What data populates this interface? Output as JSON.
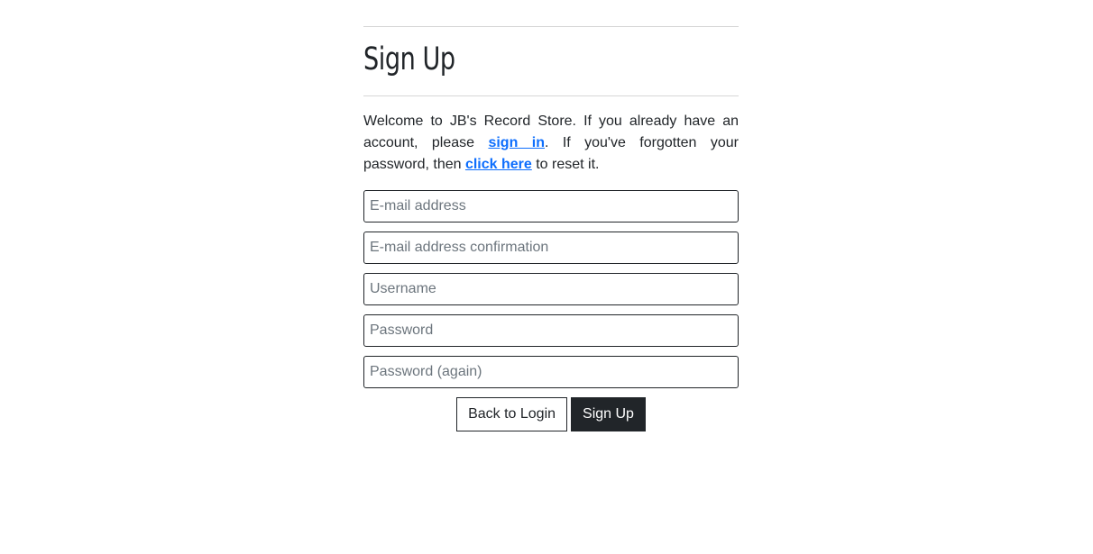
{
  "page": {
    "title": "Sign Up",
    "intro": {
      "text_before_signin": "Welcome to JB's Record Store. If you already have an account, please ",
      "signin_link": "sign in",
      "text_before_reset": ". If you've forgotten your password, then ",
      "reset_link": "click here",
      "text_after_reset": " to reset it."
    }
  },
  "form": {
    "email_placeholder": "E-mail address",
    "email_confirm_placeholder": "E-mail address confirmation",
    "username_placeholder": "Username",
    "password_placeholder": "Password",
    "password_again_placeholder": "Password (again)"
  },
  "buttons": {
    "back_label": "Back to Login",
    "signup_label": "Sign Up"
  }
}
